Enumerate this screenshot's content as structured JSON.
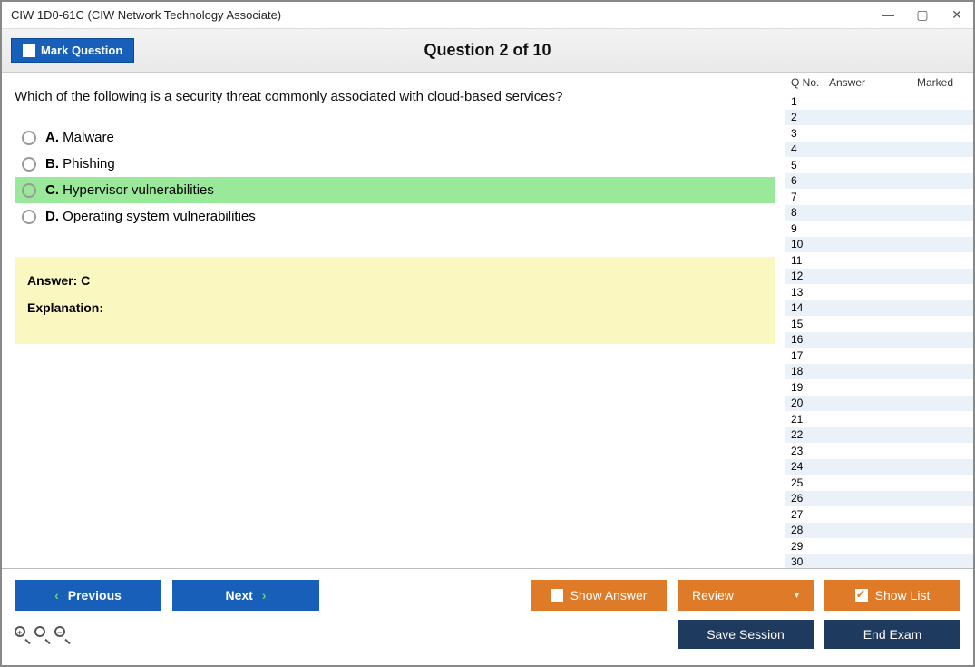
{
  "window": {
    "title": "CIW 1D0-61C (CIW Network Technology Associate)"
  },
  "header": {
    "mark_label": "Mark Question",
    "counter": "Question 2 of 10"
  },
  "question": {
    "text": "Which of the following is a security threat commonly associated with cloud-based services?",
    "choices": [
      {
        "letter": "A.",
        "text": "Malware",
        "highlight": false
      },
      {
        "letter": "B.",
        "text": "Phishing",
        "highlight": false
      },
      {
        "letter": "C.",
        "text": "Hypervisor vulnerabilities",
        "highlight": true
      },
      {
        "letter": "D.",
        "text": "Operating system vulnerabilities",
        "highlight": false
      }
    ],
    "answer_label": "Answer: C",
    "explanation_label": "Explanation:"
  },
  "side": {
    "col_qno": "Q No.",
    "col_ans": "Answer",
    "col_mark": "Marked",
    "rows": [
      1,
      2,
      3,
      4,
      5,
      6,
      7,
      8,
      9,
      10,
      11,
      12,
      13,
      14,
      15,
      16,
      17,
      18,
      19,
      20,
      21,
      22,
      23,
      24,
      25,
      26,
      27,
      28,
      29,
      30
    ]
  },
  "footer": {
    "previous": "Previous",
    "next": "Next",
    "show_answer": "Show Answer",
    "review": "Review",
    "show_list": "Show List",
    "save_session": "Save Session",
    "end_exam": "End Exam"
  }
}
